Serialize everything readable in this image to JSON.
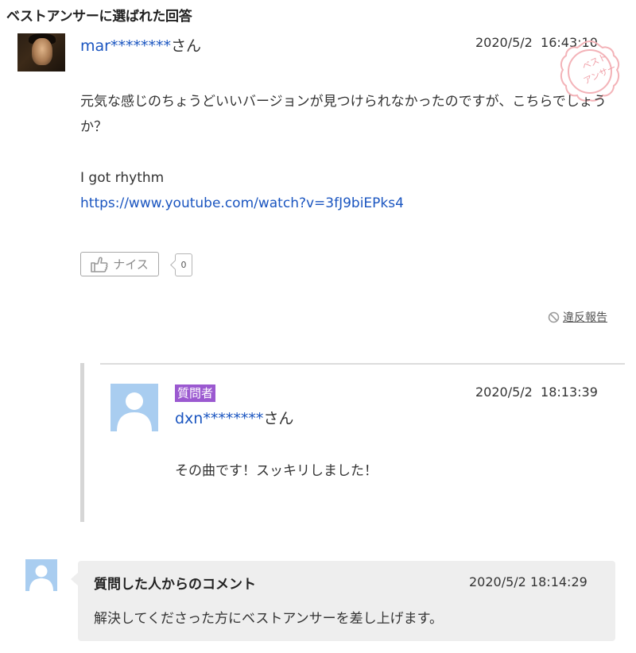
{
  "section": {
    "title": "ベストアンサーに選ばれた回答"
  },
  "answer": {
    "user_masked": "mar********",
    "user_suffix": "さん",
    "date": "2020/5/2  16:43:10",
    "paragraph1": "元気な感じのちょうどいいバージョンが見つけられなかったのですが、こちらでしょうか？",
    "song": "I got rhythm",
    "link": "https://www.youtube.com/watch?v=3fJ9biEPks4",
    "nice_label": "ナイス",
    "nice_count": "0",
    "report_label": "違反報告",
    "stamp_text_1": "ベスト",
    "stamp_text_2": "アンサー",
    "stamp_color": "#f3b3b8"
  },
  "reply": {
    "badge": "質問者",
    "badge_color": "#9b59d0",
    "user_masked": "dxn********",
    "user_suffix": "さん",
    "date": "2020/5/2  18:13:39",
    "text": "その曲です！スッキリしました！"
  },
  "comment": {
    "title": "質問した人からのコメント",
    "date": "2020/5/2 18:14:29",
    "text": "解決してくださった方にベストアンサーを差し上げます。"
  },
  "colors": {
    "link": "#1a55c0",
    "avatar_placeholder": "#a9cdf0"
  }
}
